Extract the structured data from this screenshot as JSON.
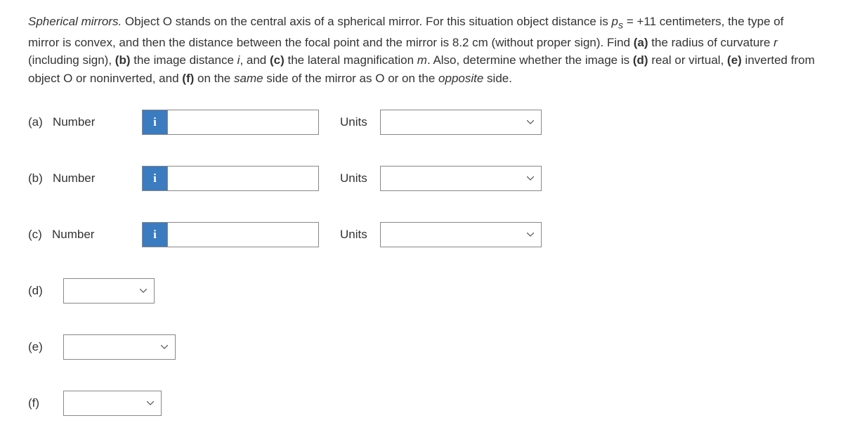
{
  "problem": {
    "part1_italic": "Spherical mirrors.",
    "part1_rest": " Object ",
    "O1": "O",
    "part2": " stands on the central axis of a spherical mirror. For this situation object distance is ",
    "ps_var": "p",
    "ps_sub": "s",
    "ps_eq": " = +11 centimeters, the type of mirror is convex, and then the distance between the focal point and the mirror is 8.2 cm (without proper sign). Find ",
    "a_bold": "(a)",
    "a_txt": " the radius of curvature ",
    "r_var": "r",
    "r_txt": " (including sign), ",
    "b_bold": "(b)",
    "b_txt": " the image distance ",
    "i_var": "i",
    "i_rest": ", and ",
    "c_bold": "(c)",
    "c_txt": " the lateral magnification ",
    "m_var": "m",
    "m_rest": ". Also, determine whether the image is ",
    "d_bold": "(d)",
    "d_txt": " real or virtual, ",
    "e_bold": "(e)",
    "e_txt": " inverted from object ",
    "O2": "O",
    "e_rest": " or noninverted, and ",
    "f_bold": "(f)",
    "f_txt": " on the ",
    "same_italic": "same",
    "f_mid": " side of the mirror as ",
    "O3": "O",
    "f_or": " or on the ",
    "opp_italic": "opposite",
    "f_end": " side."
  },
  "labels": {
    "number": "Number",
    "units": "Units",
    "info": "i",
    "a": "(a)",
    "b": "(b)",
    "c": "(c)",
    "d": "(d)",
    "e": "(e)",
    "f": "(f)"
  },
  "inputs": {
    "a_value": "",
    "b_value": "",
    "c_value": "",
    "a_units": "",
    "b_units": "",
    "c_units": "",
    "d_value": "",
    "e_value": "",
    "f_value": ""
  }
}
